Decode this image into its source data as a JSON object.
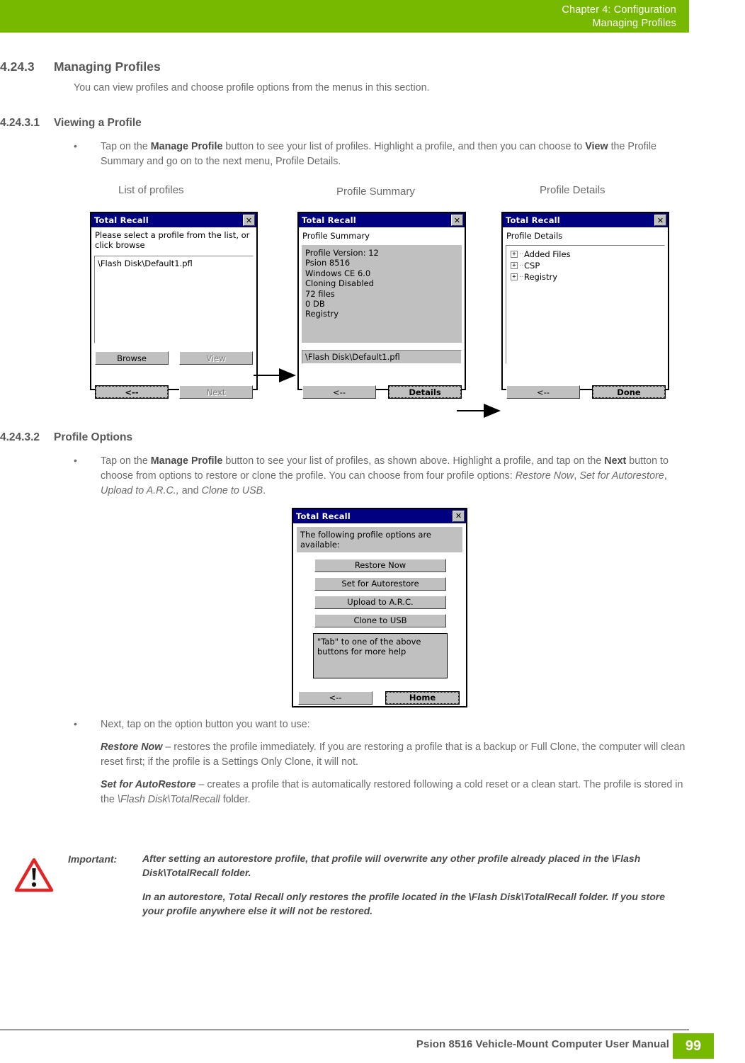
{
  "header": {
    "line1": "Chapter 4:  Configuration",
    "line2": "Managing Profiles",
    "accent_color": "#76b900"
  },
  "section_managing": {
    "number": "4.24.3",
    "title": "Managing Profiles",
    "intro": "You can view profiles and choose profile options from the menus in this section."
  },
  "section_viewing": {
    "number": "4.24.3.1",
    "title": "Viewing a Profile",
    "bullet_html": "Tap on the <b>Manage Profile</b> button to see your list of profiles. Highlight a profile, and then you can choose to <b>View</b> the Profile Summary and go on to the next menu, Profile Details."
  },
  "figure_one": {
    "labels": {
      "list": "List of profiles",
      "summary": "Profile Summary",
      "details": "Profile Details"
    },
    "dialog_list": {
      "title": "Total Recall",
      "close": "✕",
      "prompt_line1": "Please select a profile from the list, or",
      "prompt_line2": "click browse",
      "list_item": "\\Flash Disk\\Default1.pfl",
      "btn_browse": "Browse",
      "btn_view": "View",
      "btn_back": "<--",
      "btn_next": "Next"
    },
    "dialog_summary": {
      "title": "Total Recall",
      "close": "✕",
      "heading": "Profile Summary",
      "details_lines": [
        "Profile Version: 12",
        "Psion 8516",
        "Windows CE 6.0",
        "Cloning Disabled",
        "72 files",
        "0 DB",
        "Registry"
      ],
      "path_field": "\\Flash Disk\\Default1.pfl",
      "btn_back": "<--",
      "btn_details": "Details"
    },
    "dialog_details": {
      "title": "Total Recall",
      "close": "✕",
      "heading": "Profile Details",
      "tree": [
        "Added Files",
        "CSP",
        "Registry"
      ],
      "expander": "+",
      "btn_back": "<--",
      "btn_done": "Done"
    }
  },
  "section_options": {
    "number": "4.24.3.2",
    "title": "Profile Options",
    "bullet_html": "Tap on the <b>Manage Profile</b> button to see your list of profiles, as shown above. Highlight a profile, and tap on the <b>Next</b> button to choose from options to restore or clone the profile. You can choose from four profile options: <i>Restore Now</i>, <i>Set for Autorestore</i>, <i>Upload to A.R.C.,</i>  and <i>Clone to USB</i>."
  },
  "dialog_options": {
    "title": "Total Recall",
    "close": "✕",
    "intro_line1": "The following profile options are",
    "intro_line2": "available:",
    "buttons": [
      "Restore Now",
      "Set for Autorestore",
      "Upload to A.R.C.",
      "Clone to USB"
    ],
    "help_line1": "\"Tab\" to one of the above",
    "help_line2": "buttons for more help",
    "btn_back": "<--",
    "btn_home": "Home"
  },
  "section_next": {
    "bullet": "Next, tap on the option button you want to use:",
    "restore_now_html": "<b><i>Restore Now</i></b> &ndash; restores the profile immediately. If you are restoring a profile that is a backup or Full Clone, the computer will clean reset first; if the profile is a Settings Only Clone, it will not.",
    "autorestore_html": "<b><i>Set for AutoRestore</i></b> &ndash; creates a profile that is automatically restored following a cold reset or a clean start. The profile is stored in the <i>\\Flash Disk\\TotalRecall</i> folder."
  },
  "callout": {
    "icon": "warning-triangle",
    "icon_color": "#e32525",
    "label": "Important:",
    "paragraph1": "After setting an autorestore profile, that profile will overwrite any other profile already placed in the \\Flash Disk\\TotalRecall folder.",
    "paragraph2": "In an autorestore, Total Recall only restores the profile located in the \\Flash Disk\\TotalRecall folder. If you store your profile anywhere else it will not be restored."
  },
  "footer": {
    "title": "Psion 8516 Vehicle-Mount Computer User Manual",
    "page_number": "99"
  }
}
